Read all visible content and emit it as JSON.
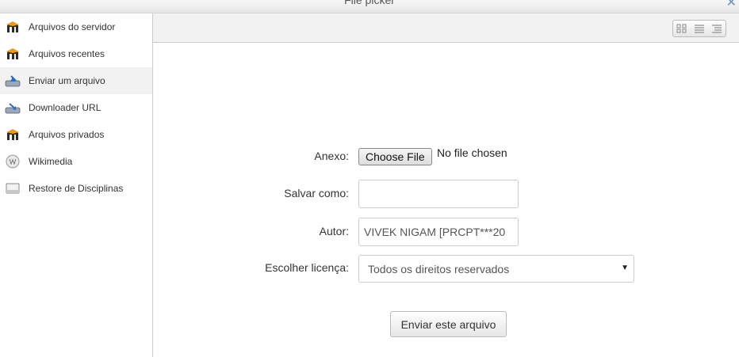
{
  "window": {
    "title": "File picker"
  },
  "sidebar": {
    "items": [
      {
        "label": "Arquivos do servidor",
        "icon": "moodle-icon",
        "active": false
      },
      {
        "label": "Arquivos recentes",
        "icon": "moodle-icon",
        "active": false
      },
      {
        "label": "Enviar um arquivo",
        "icon": "upload-icon",
        "active": true
      },
      {
        "label": "Downloader URL",
        "icon": "download-icon",
        "active": false
      },
      {
        "label": "Arquivos privados",
        "icon": "moodle-icon",
        "active": false
      },
      {
        "label": "Wikimedia",
        "icon": "wikimedia-icon",
        "active": false
      },
      {
        "label": "Restore de Disciplinas",
        "icon": "drive-icon",
        "active": false
      }
    ]
  },
  "toolbar": {
    "views": [
      "icons-view-icon",
      "list-view-icon",
      "tree-view-icon"
    ]
  },
  "form": {
    "attachment_label": "Anexo:",
    "choose_file_label": "Choose File",
    "no_file_text": "No file chosen",
    "save_as_label": "Salvar como:",
    "save_as_value": "",
    "author_label": "Autor:",
    "author_value": "VIVEK NIGAM [PRCPT***20",
    "license_label": "Escolher licença:",
    "license_value": "Todos os direitos reservados",
    "submit_label": "Enviar este arquivo"
  },
  "colors": {
    "sidebar_active": "#f2f2f2",
    "toolbar_bg": "#f2f2f2"
  }
}
